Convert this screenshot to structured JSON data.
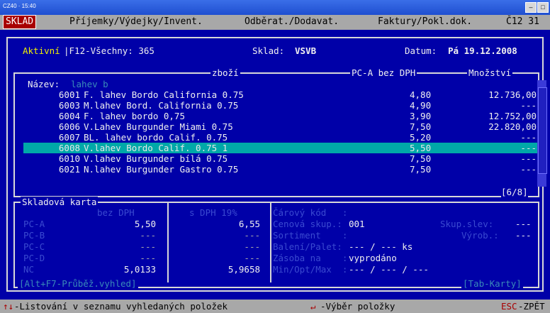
{
  "window": {
    "title": "CZ40 · 15:40"
  },
  "menu": {
    "active": "SKLAD",
    "items": [
      "Příjemky/Výdejky/Invent.",
      "Odběrat./Dodavat.",
      "Faktury/Pokl.dok.",
      "Č12 31"
    ]
  },
  "header": {
    "filter_active": "Aktivní",
    "filter_all": "|F12-Všechny: 365",
    "sklad_label": "Sklad:",
    "sklad_value": "VSVB",
    "datum_label": "Datum:",
    "datum_value": "Pá 19.12.2008"
  },
  "list": {
    "col_zbozi": "zboží",
    "col_price": "PC-A bez DPH",
    "col_qty": "Množství",
    "search_label": "Název:",
    "search_value": "lahev b",
    "rows": [
      {
        "num": "6001",
        "name": "F. lahev Bordo California 0.75",
        "price": "4,80",
        "qty": "12.736,00"
      },
      {
        "num": "6003",
        "name": "M.lahev Bord. California 0.75",
        "price": "4,90",
        "qty": "---"
      },
      {
        "num": "6004",
        "name": "F. lahev bordo 0,75",
        "price": "3,90",
        "qty": "12.752,00"
      },
      {
        "num": "6006",
        "name": "V.Lahev Burgunder Miami 0.75",
        "price": "7,50",
        "qty": "22.820,00"
      },
      {
        "num": "6007",
        "name": "BL. lahev bordo Calif. 0.75",
        "price": "5,20",
        "qty": "---"
      },
      {
        "num": "6008",
        "name": "V.lahev Bordo Calif. 0.75 1",
        "price": "5,50",
        "qty": "---"
      },
      {
        "num": "6010",
        "name": "V.lahev Burgunder bílá 0.75",
        "price": "7,50",
        "qty": "---"
      },
      {
        "num": "6021",
        "name": "N.lahev Burgunder Gastro 0.75",
        "price": "7,50",
        "qty": "---"
      }
    ],
    "page": "[6/8]"
  },
  "card": {
    "title": "Skladová karta",
    "col_bez": "bez DPH",
    "col_s": "s DPH 19%",
    "price_rows": [
      {
        "label": "PC-A",
        "bez": "5,50",
        "s": "6,55"
      },
      {
        "label": "PC-B",
        "bez": "---",
        "s": "---"
      },
      {
        "label": "PC-C",
        "bez": "---",
        "s": "---"
      },
      {
        "label": "PC-D",
        "bez": "---",
        "s": "---"
      },
      {
        "label": "NC",
        "bez": "5,0133",
        "s": "5,9658"
      }
    ],
    "carovy_label": "Čárový kód   :",
    "cenova_label": "Cenová skup.:",
    "cenova_value": "001",
    "skup_slev_label": "Skup.slev:",
    "skup_slev_value": "---",
    "sortiment_label": "Sortiment    :",
    "vyrob_label": "Výrob.:",
    "vyrob_value": "---",
    "baleni_label": "Balení/Palet:",
    "baleni_value": "--- / --- ks",
    "zasoba_label": "Zásoba na    :",
    "zasoba_value": "vyprodáno",
    "minopt_label": "Min/Opt/Max  :",
    "minopt_value": "--- / --- / ---",
    "alt_f7": "[Alt+F7-Průběž.vyhled]",
    "tab_karty": "[Tab-Karty]"
  },
  "status": {
    "arrows": "↑↓",
    "list_hint": "-Listování v seznamu vyhledaných položek",
    "enter_sym": "↵",
    "select_hint": "-Výběr položky",
    "esc": "ESC",
    "esc_hint": "-ZPĚT"
  }
}
